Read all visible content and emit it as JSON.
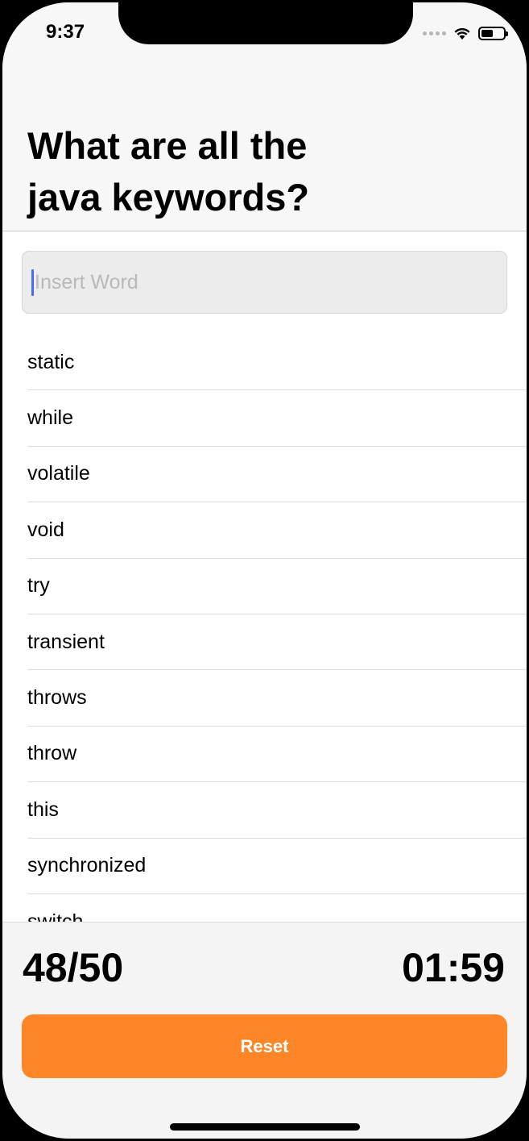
{
  "status_bar": {
    "time": "9:37",
    "icons": [
      "cellular-signal-icon",
      "wifi-icon",
      "battery-icon"
    ],
    "battery_level": 0.55
  },
  "header": {
    "title": "What are all the java keywords?"
  },
  "input": {
    "placeholder": "Insert Word",
    "value": ""
  },
  "words": [
    "static",
    "while",
    "volatile",
    "void",
    "try",
    "transient",
    "throws",
    "throw",
    "this",
    "synchronized",
    "switch"
  ],
  "footer": {
    "score": "48/50",
    "timer": "01:59",
    "reset_label": "Reset"
  },
  "colors": {
    "accent": "#fe8627",
    "cursor": "#4a6cf0"
  }
}
